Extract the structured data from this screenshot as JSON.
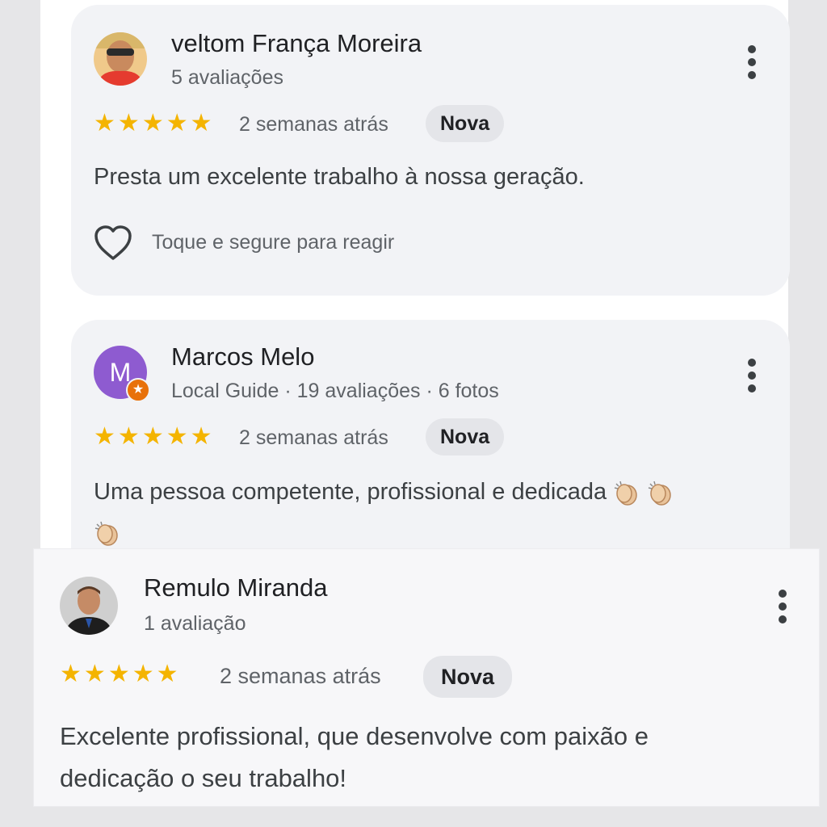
{
  "reviews": [
    {
      "name": "veltom França Moreira",
      "meta": "5 avaliações",
      "rating": 5,
      "stars": "★★★★★",
      "date": "2 semanas atrás",
      "badge": "Nova",
      "text": "Presta um excelente trabalho à nossa geração.",
      "react_label": "Toque e segure para reagir",
      "avatar_icon": "person-photo-icon"
    },
    {
      "name": "Marcos Melo",
      "meta": "Local Guide · 19 avaliações · 6 fotos",
      "avatar_letter": "M",
      "avatar_color": "#8e5bd0",
      "rating": 5,
      "stars": "★★★★★",
      "date": "2 semanas atrás",
      "badge": "Nova",
      "text": "Uma pessoa competente, profissional e dedicada",
      "emoji_icon": "clapping-hands-icon"
    },
    {
      "name": "Remulo Miranda",
      "meta": "1 avaliação",
      "rating": 5,
      "stars": "★★★★★",
      "date": "2 semanas atrás",
      "badge": "Nova",
      "text_line1": "Excelente profissional, que desenvolve com paixão e",
      "text_line2": "dedicação o seu trabalho!",
      "avatar_icon": "person-photo-icon"
    }
  ],
  "colors": {
    "star": "#f4b400",
    "badge_bg": "#e4e5e9",
    "card_bg": "#f2f3f6"
  }
}
